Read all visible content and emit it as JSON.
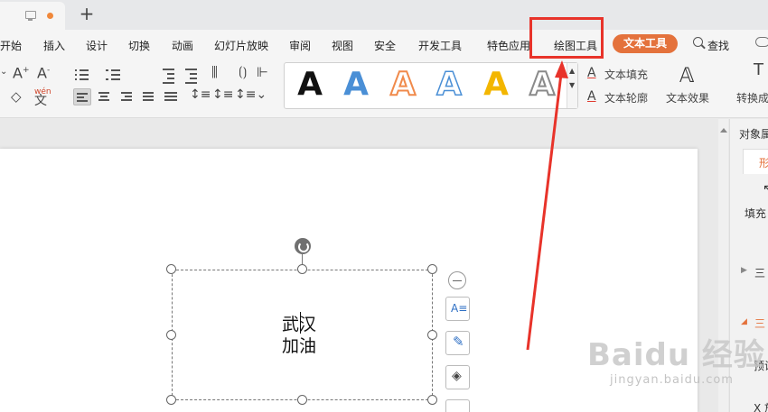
{
  "menu": {
    "items": [
      "开始",
      "插入",
      "设计",
      "切换",
      "动画",
      "幻灯片放映",
      "审阅",
      "视图",
      "安全",
      "开发工具",
      "特色应用",
      "绘图工具"
    ],
    "active_tab": "文本工具",
    "search_label": "查找"
  },
  "ribbon": {
    "text_fill": "文本填充",
    "text_outline": "文本轮廓",
    "text_effect": "文本效果",
    "convert": "转换成",
    "pinyin": "wén",
    "pinyin_char": "文",
    "style_letter": "A",
    "style_colors": [
      "#111111",
      "#4a8fd6",
      "#f08a4b",
      "#ffffff",
      "#f3b600",
      "#8a8a8a"
    ]
  },
  "textbox": {
    "line1": "武汉",
    "line2": "加油"
  },
  "panel": {
    "title": "对象属",
    "tab": "形",
    "fill": "填充",
    "item1": "三",
    "item2": "三",
    "preset": "预设",
    "x": "X 放"
  },
  "watermark": {
    "brand": "Baidu 经验",
    "url": "jingyan.baidu.com"
  },
  "colors": {
    "accent": "#e4723c",
    "annotation": "#e8332a"
  }
}
